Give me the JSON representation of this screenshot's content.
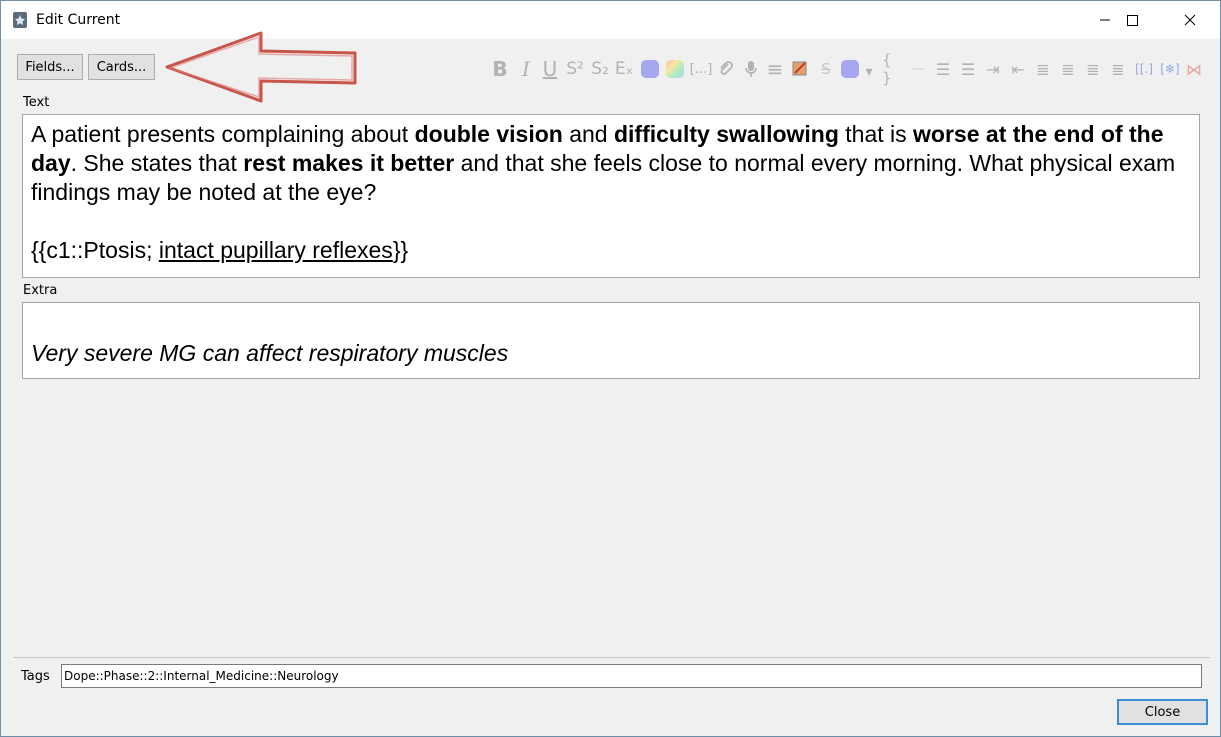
{
  "window": {
    "title": "Edit Current"
  },
  "buttons": {
    "fields": "Fields...",
    "cards": "Cards...",
    "close": "Close"
  },
  "toolbar": {
    "items": [
      {
        "name": "bold-icon",
        "glyph": "B"
      },
      {
        "name": "italic-icon",
        "glyph": "I"
      },
      {
        "name": "underline-icon",
        "glyph": "U"
      },
      {
        "name": "superscript-icon",
        "glyph": "S²"
      },
      {
        "name": "subscript-icon",
        "glyph": "S₂"
      },
      {
        "name": "clear-format-icon",
        "glyph": "Eₓ"
      },
      {
        "name": "text-color-icon",
        "glyph": ""
      },
      {
        "name": "highlight-color-icon",
        "glyph": ""
      },
      {
        "name": "cloze-icon",
        "glyph": "[...]"
      },
      {
        "name": "attach-icon",
        "glyph": "🔗"
      },
      {
        "name": "record-audio-icon",
        "glyph": "🎤"
      },
      {
        "name": "more-icon",
        "glyph": "≡"
      },
      {
        "name": "image-occlusion-icon",
        "glyph": ""
      },
      {
        "name": "strikethrough-icon",
        "glyph": "S"
      },
      {
        "name": "color-picker-icon",
        "glyph": ""
      },
      {
        "name": "dropdown-icon",
        "glyph": "▾"
      },
      {
        "name": "code-icon",
        "glyph": "{ }"
      },
      {
        "name": "horizontal-rule-icon",
        "glyph": "—"
      },
      {
        "name": "bullet-list-icon",
        "glyph": "☰"
      },
      {
        "name": "numbered-list-icon",
        "glyph": "☰"
      },
      {
        "name": "indent-icon",
        "glyph": "⇥"
      },
      {
        "name": "outdent-icon",
        "glyph": "⇤"
      },
      {
        "name": "align-center-icon",
        "glyph": "≣"
      },
      {
        "name": "align-left-icon",
        "glyph": "≣"
      },
      {
        "name": "align-right-icon",
        "glyph": "≣"
      },
      {
        "name": "justify-icon",
        "glyph": "≣"
      },
      {
        "name": "mathjax-icon",
        "glyph": "[[.]"
      },
      {
        "name": "snowflake-icon",
        "glyph": "[❄]"
      },
      {
        "name": "remove-format-icon",
        "glyph": "⋈"
      }
    ]
  },
  "fields": {
    "text_label": "Text",
    "text": {
      "p1": "A patient presents complaining about ",
      "b1": "double vision",
      "p2": " and ",
      "b2": "difficulty swallowing",
      "p3": " that is ",
      "b3": "worse at the end of the day",
      "p4": ". She states that ",
      "b4": "rest makes it better",
      "p5": " and that she feels close to normal every morning. What physical exam findings may be noted at the eye?",
      "cloze_open": "{{c1::Ptosis; ",
      "cloze_underlined": "intact pupillary reflexes",
      "cloze_close": "}}"
    },
    "extra_label": "Extra",
    "extra": "Very severe MG can affect respiratory muscles"
  },
  "tags": {
    "label": "Tags",
    "value": "Dope::Phase::2::Internal_Medicine::Neurology"
  },
  "colors": {
    "accent": "#3c8fd6",
    "annotation_arrow": "#c0392b"
  }
}
